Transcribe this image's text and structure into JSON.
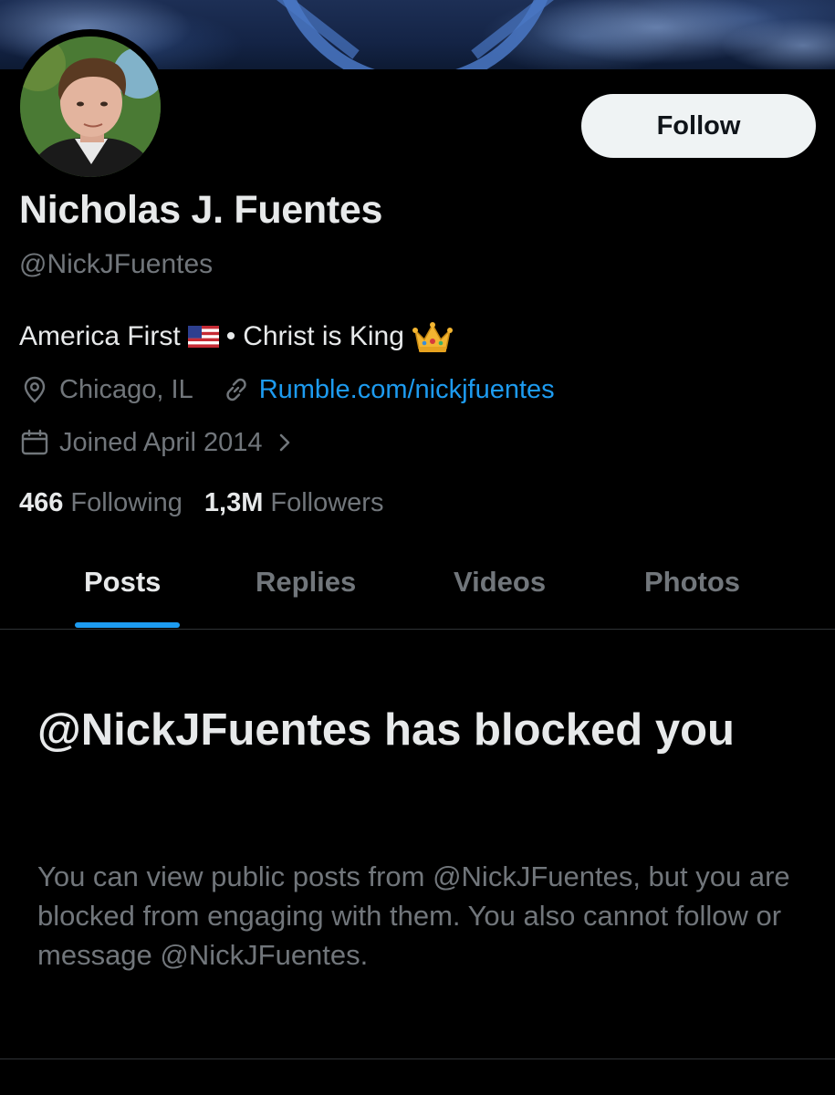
{
  "colors": {
    "background": "#000000",
    "text_primary": "#e7e9ea",
    "text_secondary": "#71767b",
    "accent": "#1d9bf0",
    "follow_button_bg": "#eff3f4",
    "divider": "#2f3336"
  },
  "profile": {
    "name": "Nicholas J. Fuentes",
    "handle": "@NickJFuentes",
    "follow_label": "Follow",
    "bio_part1": "America First",
    "bio_separator": "•",
    "bio_part2": "Christ is King",
    "bio_emojis": [
      "us-flag-emoji",
      "crown-emoji"
    ],
    "location": "Chicago, IL",
    "website": "Rumble.com/nickjfuentes",
    "joined": "Joined April 2014",
    "following_count": "466",
    "following_label": "Following",
    "followers_count": "1,3M",
    "followers_label": "Followers"
  },
  "tabs": [
    {
      "label": "Posts",
      "active": true
    },
    {
      "label": "Replies",
      "active": false
    },
    {
      "label": "Videos",
      "active": false
    },
    {
      "label": "Photos",
      "active": false
    }
  ],
  "blocked": {
    "title": "@NickJFuentes has blocked you",
    "message": "You can view public posts from @NickJFuentes, but you are blocked from engaging with them. You also cannot follow or message @NickJFuentes."
  },
  "icons": {
    "location": "location-pin-icon",
    "link": "link-icon",
    "calendar": "calendar-icon",
    "chevron": "chevron-right-icon"
  }
}
